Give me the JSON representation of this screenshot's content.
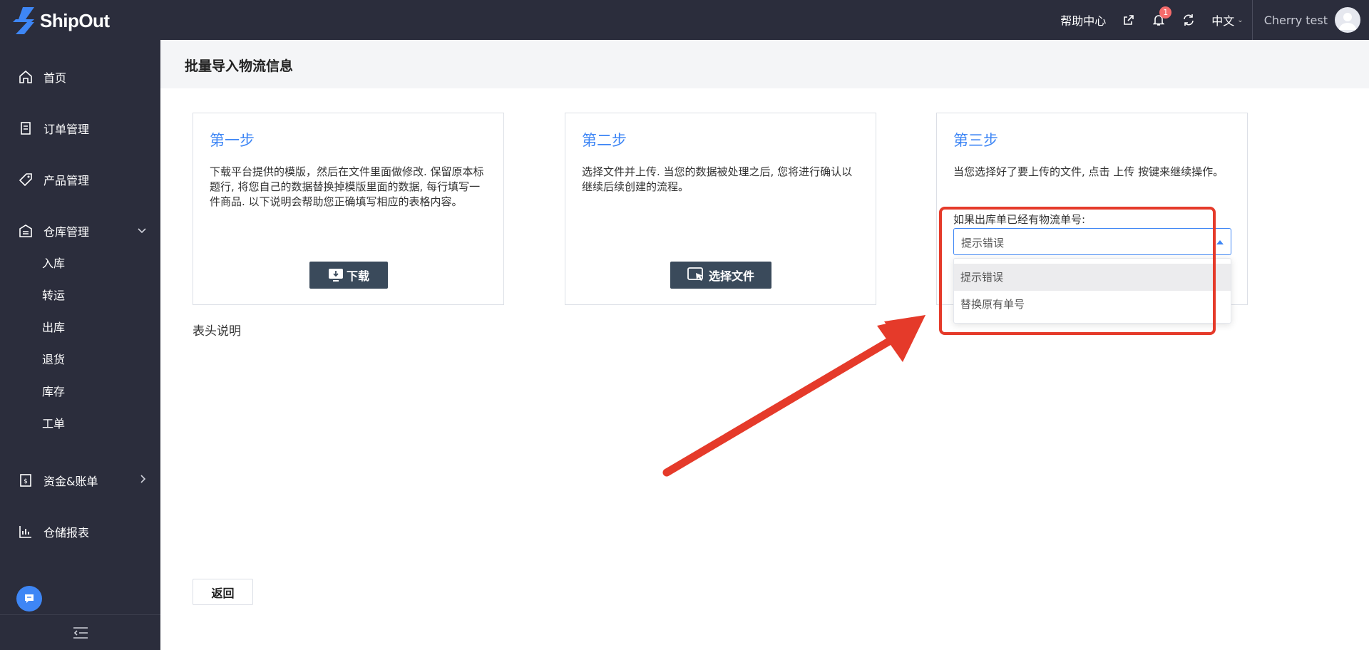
{
  "brand": {
    "name": "ShipOut",
    "logo_icon": "lightning-bolt-icon",
    "accent": "#3e86f5"
  },
  "topbar": {
    "help_label": "帮助中心",
    "notification_count": "1",
    "language": "中文",
    "user_name": "Cherry test",
    "icons": [
      "share-icon",
      "bell-icon",
      "refresh-icon",
      "avatar-icon"
    ]
  },
  "sidebar": {
    "items": [
      {
        "label": "首页",
        "icon": "home-icon"
      },
      {
        "label": "订单管理",
        "icon": "order-icon"
      },
      {
        "label": "产品管理",
        "icon": "tag-icon"
      },
      {
        "label": "仓库管理",
        "icon": "warehouse-icon",
        "expanded": true
      },
      {
        "label": "资金&账单",
        "icon": "billing-icon"
      },
      {
        "label": "仓储报表",
        "icon": "chart-icon"
      }
    ],
    "sub_items": [
      "入库",
      "转运",
      "出库",
      "退货",
      "库存",
      "工单"
    ]
  },
  "page": {
    "title": "批量导入物流信息",
    "steps": [
      {
        "title": "第一步",
        "desc": "下载平台提供的模版，然后在文件里面做修改. 保留原本标题行, 将您自己的数据替换掉模版里面的数据, 每行填写一件商品. 以下说明会帮助您正确填写相应的表格内容。",
        "button": "下载"
      },
      {
        "title": "第二步",
        "desc": "选择文件并上传. 当您的数据被处理之后, 您将进行确认以继续后续创建的流程。",
        "button": "选择文件"
      },
      {
        "title": "第三步",
        "desc": "当您选择好了要上传的文件, 点击 上传 按键来继续操作。"
      }
    ],
    "select": {
      "label": "如果出库单已经有物流单号:",
      "value": "提示错误",
      "options": [
        "提示错误",
        "替换原有单号"
      ]
    },
    "table_header_label": "表头说明",
    "back_button": "返回"
  },
  "colors": {
    "annotation": "#e53a2a",
    "sidebar_bg": "#2b2d3c"
  }
}
